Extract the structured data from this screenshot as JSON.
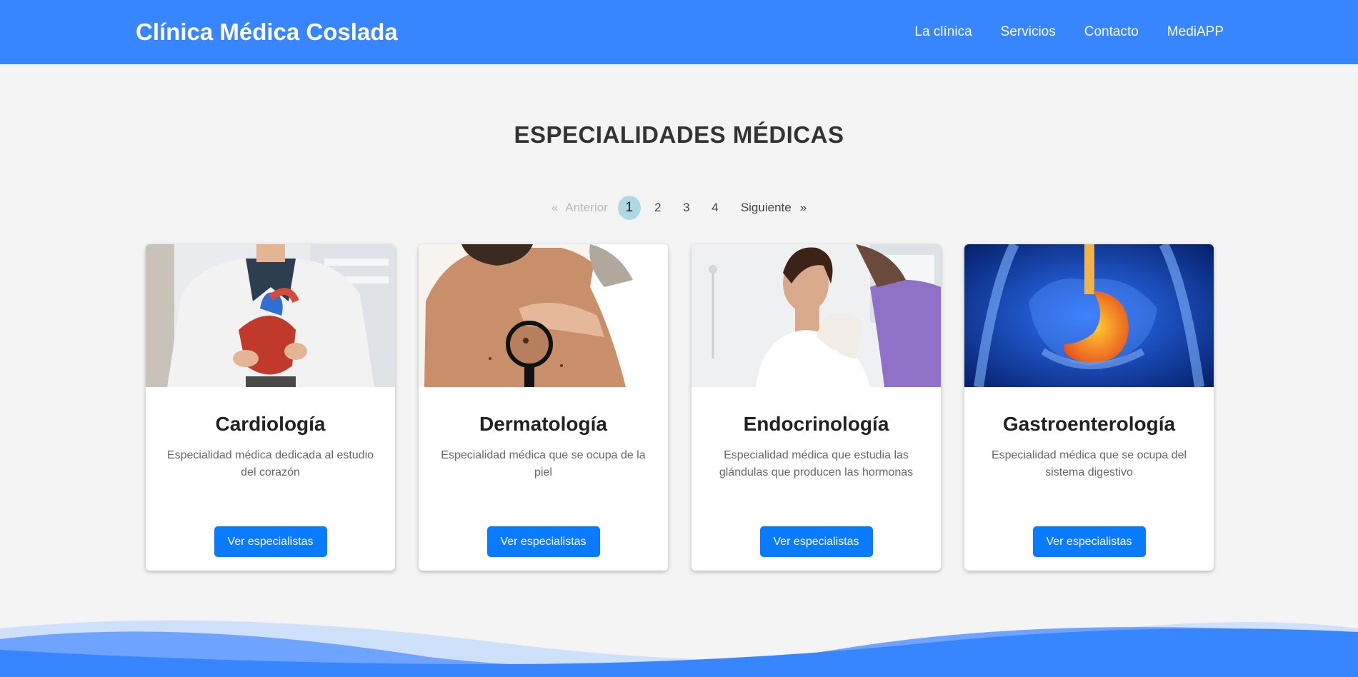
{
  "header": {
    "brand": "Clínica Médica Coslada",
    "nav": [
      "La clínica",
      "Servicios",
      "Contacto",
      "MediAPP"
    ]
  },
  "main": {
    "title": "ESPECIALIDADES MÉDICAS",
    "pagination": {
      "prev_arrow": "«",
      "prev_label": "Anterior",
      "pages": [
        "1",
        "2",
        "3",
        "4"
      ],
      "current": "1",
      "next_label": "Siguiente",
      "next_arrow": "»"
    },
    "cards": [
      {
        "title": "Cardiología",
        "description": "Especialidad médica dedicada al estudio del corazón",
        "button": "Ver especialistas",
        "image": "cardiology-photo"
      },
      {
        "title": "Dermatología",
        "description": "Especialidad médica que se ocupa de la piel",
        "button": "Ver especialistas",
        "image": "dermatology-photo"
      },
      {
        "title": "Endocrinología",
        "description": "Especialidad médica que estudia las glándulas que producen las hormonas",
        "button": "Ver especialistas",
        "image": "endocrinology-photo"
      },
      {
        "title": "Gastroenterología",
        "description": "Especialidad médica que se ocupa del sistema digestivo",
        "button": "Ver especialistas",
        "image": "gastroenterology-photo"
      }
    ]
  },
  "colors": {
    "header_bg": "#3886ff",
    "page_bg": "#f4f4f4",
    "button_bg": "#0a7bff",
    "active_page_bg": "#add8e6",
    "wave_dark": "#3886ff",
    "wave_light": "#cfe0fb"
  }
}
